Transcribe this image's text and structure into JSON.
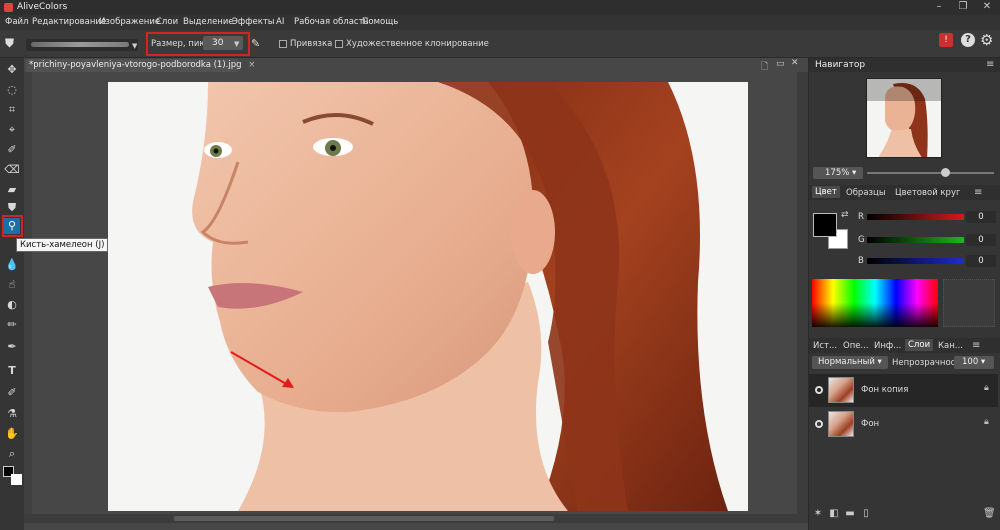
{
  "app": {
    "title": "AliveColors"
  },
  "menu": [
    "Файл",
    "Редактирование",
    "Изображение",
    "Слои",
    "Выделение",
    "Эффекты",
    "AI",
    "Рабочая область",
    "Помощь"
  ],
  "options": {
    "size_label": "Размер, пикс",
    "size_value": "30",
    "snap_label": "Привязка",
    "art_clone_label": "Художественное клонирование"
  },
  "document": {
    "tab_title": "*prichiny-poyavleniya-vtorogo-podborodka (1).jpg",
    "tab_close": "×"
  },
  "tooltip": "Кисть-хамелеон (J)",
  "navigator": {
    "title": "Навигатор",
    "zoom": "175%",
    "zoom_slider_fraction": 0.6
  },
  "color_panel": {
    "tabs": [
      "Цвет",
      "Образцы",
      "Цветовой круг"
    ],
    "channels": [
      {
        "label": "R",
        "value": "0",
        "color": "#d21c1c"
      },
      {
        "label": "G",
        "value": "0",
        "color": "#1fb51f"
      },
      {
        "label": "B",
        "value": "0",
        "color": "#1c2dd2"
      }
    ]
  },
  "layers_panel": {
    "tabs": [
      "Ист...",
      "Опе...",
      "Инф...",
      "Слои",
      "Кан..."
    ],
    "blend_mode": "Нормальный",
    "opacity_label": "Непрозрачность",
    "opacity_value": "100",
    "layers": [
      {
        "name": "Фон копия",
        "selected": true
      },
      {
        "name": "Фон",
        "selected": false
      }
    ]
  },
  "colors": {
    "highlight_red": "#d32424",
    "active_tool": "#1d6fa5"
  }
}
